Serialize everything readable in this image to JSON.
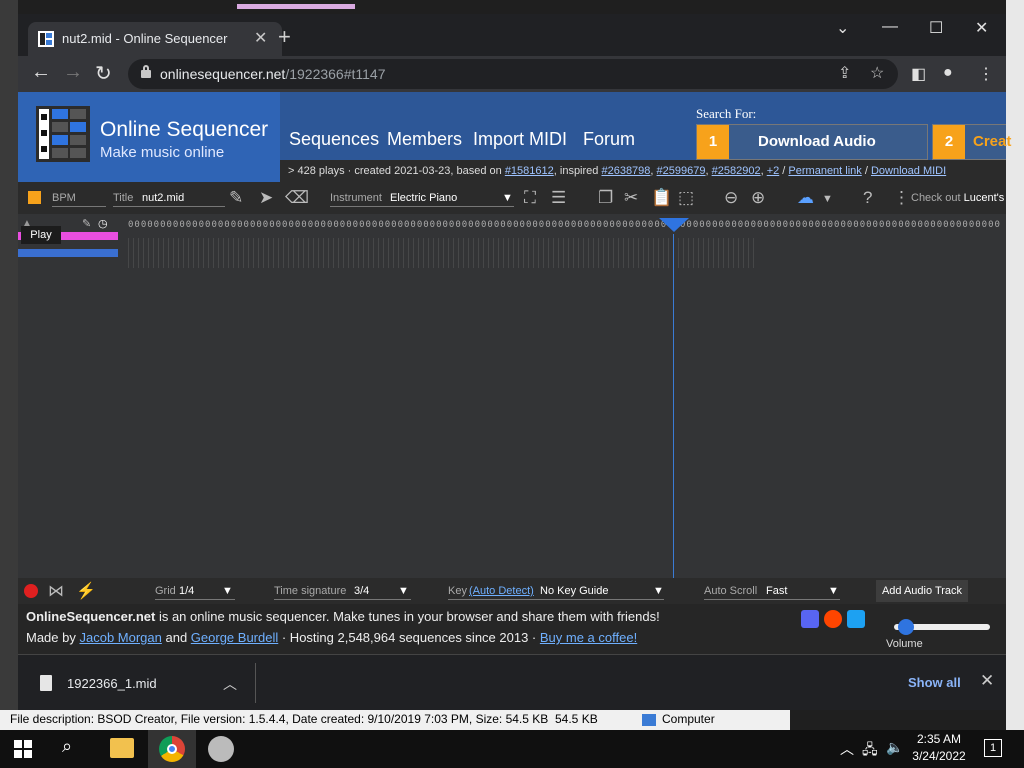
{
  "browser": {
    "tab_title": "nut2.mid - Online Sequencer",
    "tab_close": "✕",
    "new_tab": "+",
    "url_host": "onlinesequencer.net",
    "url_path": "/1922366#t1147",
    "win_min": "—",
    "win_max": "☐",
    "win_close": "✕"
  },
  "site": {
    "brand": "Online Sequencer",
    "tagline": "Make music online",
    "nav": [
      "Sequences",
      "Members",
      "Import MIDI",
      "Forum"
    ],
    "search_for": "Search For:",
    "ad1_num": "1",
    "ad1_text": "Download Audio",
    "ad2_num": "2",
    "ad2_text": "Creat",
    "info": {
      "prefix": "428 plays · created 2021-03-23, based on ",
      "based_on": "#1581612",
      "inspired_label": ", inspired ",
      "inspired": [
        "#2638798",
        "#2599679",
        "#2582902",
        "+2"
      ],
      "permanent": "Permanent link",
      "download_midi": "Download MIDI",
      "sep": " / "
    }
  },
  "toolbar": {
    "bpm_label": "BPM",
    "title_label": "Title",
    "title_value": "nut2.mid",
    "instrument_label": "Instrument",
    "instrument_value": "Electric Piano",
    "check_out": "Check out",
    "lucent": "Lucent's"
  },
  "sequencer": {
    "play_label": "Play",
    "ruler_text": "0000000000000000000000000000000000000000000000000000000000000000000000000000000000000000000000000000000000000000000000000000000000000000"
  },
  "bottom": {
    "grid_label": "Grid",
    "grid_value": "1/4",
    "timesig_label": "Time signature",
    "timesig_value": "3/4",
    "key_label": "Key",
    "key_auto": "(Auto Detect)",
    "key_value": "No Key Guide",
    "autoscroll_label": "Auto Scroll",
    "autoscroll_value": "Fast",
    "add_audio": "Add Audio Track"
  },
  "footer": {
    "site_bold": "OnlineSequencer.net",
    "line1_rest": " is an online music sequencer. Make tunes in your browser and share them with friends!",
    "made_by": "Made by ",
    "author1": "Jacob Morgan",
    "and": " and ",
    "author2": "George Burdell",
    "hosting": " · Hosting 2,548,964 sequences since 2013 · ",
    "coffee": "Buy me a coffee!",
    "volume_label": "Volume",
    "volume_level": 0.12
  },
  "download": {
    "file": "1922366_1.mid",
    "show_all": "Show all",
    "close": "✕"
  },
  "explorer": {
    "description": "File description: BSOD Creator, File version: 1.5.4.4, Date created: 9/10/2019 7:03 PM, Size: 54.5 KB",
    "size": "54.5 KB",
    "location": "Computer"
  },
  "taskbar": {
    "time": "2:35 AM",
    "date": "3/24/2022",
    "notif_count": "1"
  },
  "colors": {
    "accent": "#2f74e0",
    "header_blue": "#2d5797",
    "orange": "#f7a21b",
    "pink": "#e94ee0"
  }
}
